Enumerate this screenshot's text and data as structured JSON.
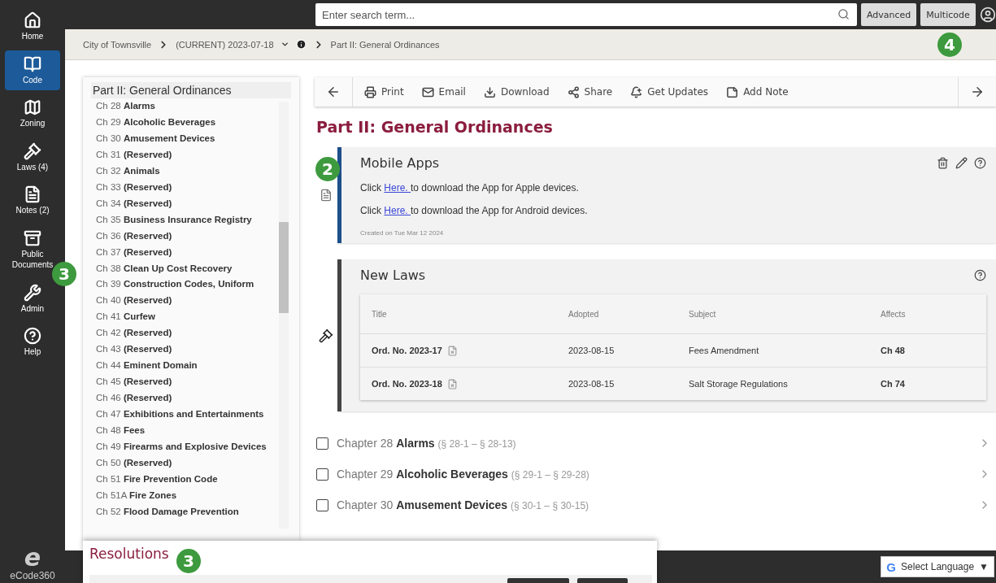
{
  "nav": {
    "items": [
      {
        "kind": "home",
        "label": "Home",
        "selected": false
      },
      {
        "kind": "code",
        "label": "Code",
        "selected": true
      },
      {
        "kind": "zoning",
        "label": "Zoning",
        "selected": false
      },
      {
        "kind": "laws",
        "label": "Laws (4)",
        "selected": false
      },
      {
        "kind": "notes",
        "label": "Notes (2)",
        "selected": false
      },
      {
        "kind": "documents",
        "label": "Public Documents",
        "selected": false,
        "callout": "3"
      },
      {
        "kind": "admin",
        "label": "Admin",
        "selected": false
      },
      {
        "kind": "help",
        "label": "Help",
        "selected": false
      }
    ],
    "logo_letter": "e",
    "logo_text": "eCode360"
  },
  "search": {
    "placeholder": "Enter search term...",
    "buttons": [
      "Advanced",
      "Multicode"
    ],
    "callout": "4"
  },
  "breadcrumb": [
    "City of Townsville",
    "(CURRENT) 2023-07-18",
    "Part II: General Ordinances"
  ],
  "toc": {
    "title": "Part II: General Ordinances",
    "items": [
      {
        "number": "Ch 28",
        "title": "Alarms"
      },
      {
        "number": "Ch 29",
        "title": "Alcoholic Beverages"
      },
      {
        "number": "Ch 30",
        "title": "Amusement Devices"
      },
      {
        "number": "Ch 31",
        "title": "(Reserved)"
      },
      {
        "number": "Ch 32",
        "title": "Animals"
      },
      {
        "number": "Ch 33",
        "title": "(Reserved)"
      },
      {
        "number": "Ch 34",
        "title": "(Reserved)"
      },
      {
        "number": "Ch 35",
        "title": "Business Insurance Registry"
      },
      {
        "number": "Ch 36",
        "title": "(Reserved)"
      },
      {
        "number": "Ch 37",
        "title": "(Reserved)"
      },
      {
        "number": "Ch 38",
        "title": "Clean Up Cost Recovery"
      },
      {
        "number": "Ch 39",
        "title": "Construction Codes, Uniform"
      },
      {
        "number": "Ch 40",
        "title": "(Reserved)"
      },
      {
        "number": "Ch 41",
        "title": "Curfew"
      },
      {
        "number": "Ch 42",
        "title": "(Reserved)"
      },
      {
        "number": "Ch 43",
        "title": "(Reserved)"
      },
      {
        "number": "Ch 44",
        "title": "Eminent Domain"
      },
      {
        "number": "Ch 45",
        "title": "(Reserved)"
      },
      {
        "number": "Ch 46",
        "title": "(Reserved)"
      },
      {
        "number": "Ch 47",
        "title": "Exhibitions and Entertainments"
      },
      {
        "number": "Ch 48",
        "title": "Fees"
      },
      {
        "number": "Ch 49",
        "title": "Firearms and Explosive Devices"
      },
      {
        "number": "Ch 50",
        "title": "(Reserved)"
      },
      {
        "number": "Ch 51",
        "title": "Fire Prevention Code"
      },
      {
        "number": "Ch 51A",
        "title": "Fire Zones"
      },
      {
        "number": "Ch 52",
        "title": "Flood Damage Prevention"
      }
    ]
  },
  "toolbar": [
    {
      "kind": "print",
      "label": "Print"
    },
    {
      "kind": "email",
      "label": "Email"
    },
    {
      "kind": "download",
      "label": "Download"
    },
    {
      "kind": "share",
      "label": "Share"
    },
    {
      "kind": "updates",
      "label": "Get Updates"
    },
    {
      "kind": "note",
      "label": "Add Note"
    }
  ],
  "page_title": "Part II: General Ordinances",
  "mobile_apps": {
    "title": "Mobile Apps",
    "callout": "2",
    "paragraphs": [
      {
        "before": "Click ",
        "link": "Here. ",
        "after": "to download the App for Apple devices."
      },
      {
        "before": "Click ",
        "link": "Here. ",
        "after": "to download the App for Android devices."
      }
    ],
    "created": "Created on Tue Mar 12 2024"
  },
  "new_laws": {
    "title": "New Laws",
    "columns": [
      "Title",
      "Adopted",
      "Subject",
      "Affects"
    ],
    "rows": [
      {
        "title": "Ord. No. 2023-17",
        "adopted": "2023-08-15",
        "subject": "Fees Amendment",
        "affects": "Ch 48"
      },
      {
        "title": "Ord. No. 2023-18",
        "adopted": "2023-08-15",
        "subject": "Salt Storage Regulations",
        "affects": "Ch 74"
      }
    ]
  },
  "chapters": [
    {
      "number": "Chapter 28",
      "title": "Alarms",
      "range": "(§ 28-1 – § 28-13)",
      "checked": false
    },
    {
      "number": "Chapter 29",
      "title": "Alcoholic Beverages",
      "range": "(§ 29-1 – § 29-28)",
      "checked": false
    },
    {
      "number": "Chapter 30",
      "title": "Amusement Devices",
      "range": "(§ 30-1 – § 30-15)",
      "checked": false
    }
  ],
  "resolutions": {
    "title": "Resolutions",
    "callout": "3"
  },
  "language": {
    "logo_letter": "G",
    "label": "Select Language",
    "caret": "▼"
  }
}
